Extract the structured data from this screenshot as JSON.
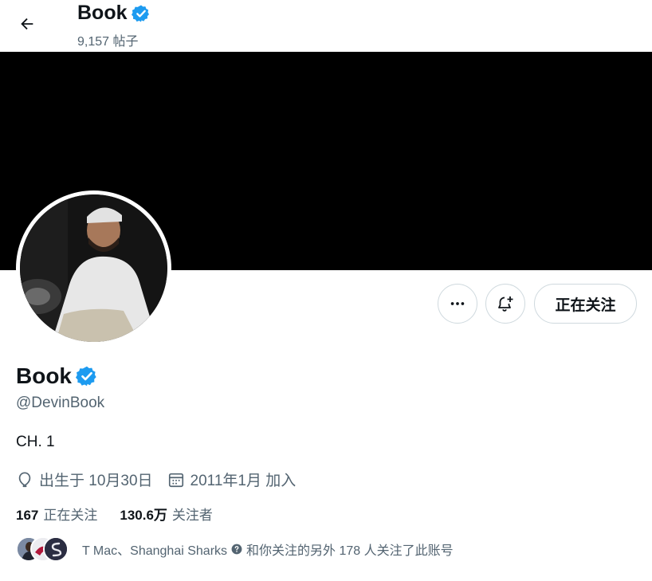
{
  "header": {
    "name": "Book",
    "posts_count": "9,157 帖子"
  },
  "colors": {
    "verified_blue": "#1d9bf0",
    "banner": "#000000",
    "secondary_text": "#536471"
  },
  "actions": {
    "more_icon": "more-horizontal-icon",
    "notify_icon": "bell-plus-icon",
    "follow_label": "正在关注"
  },
  "profile": {
    "name": "Book",
    "handle": "@DevinBook",
    "bio": "CH. 1",
    "birthday": "出生于 10月30日",
    "joined": "2011年1月 加入"
  },
  "counts": {
    "following_num": "167",
    "following_label": "正在关注",
    "followers_num": "130.6万",
    "followers_label": "关注者"
  },
  "followed_by": {
    "names": "T Mac、Shanghai Sharks",
    "suffix": "和你关注的另外 178 人关注了此账号"
  }
}
